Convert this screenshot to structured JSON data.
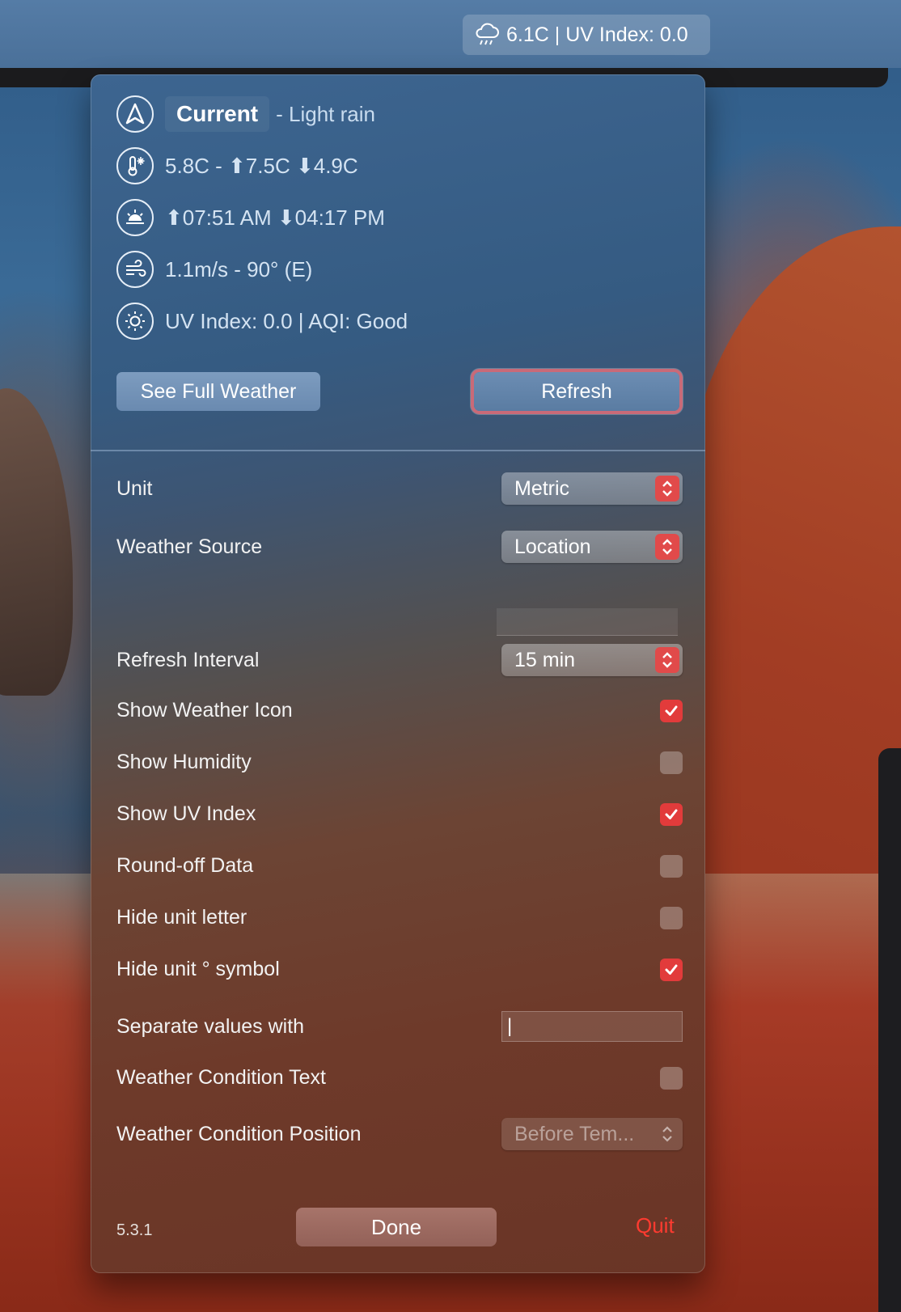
{
  "menubar": {
    "status_text": "6.1C | UV Index: 0.0",
    "status_icon": "cloud-rain-icon"
  },
  "current": {
    "label": "Current",
    "condition": "- Light rain",
    "temperature": "5.8C - ⬆7.5C ⬇4.9C",
    "sun_times": "⬆07:51 AM ⬇04:17 PM",
    "wind": "1.1m/s - 90° (E)",
    "uv_aqi": "UV Index: 0.0 | AQI: Good"
  },
  "buttons": {
    "see_full_weather": "See Full Weather",
    "refresh": "Refresh",
    "done": "Done",
    "quit": "Quit"
  },
  "settings": {
    "unit": {
      "label": "Unit",
      "value": "Metric"
    },
    "weather_source": {
      "label": "Weather Source",
      "value": "Location"
    },
    "refresh_interval": {
      "label": "Refresh Interval",
      "value": "15 min"
    },
    "show_weather_icon": {
      "label": "Show Weather Icon",
      "checked": true
    },
    "show_humidity": {
      "label": "Show Humidity",
      "checked": false
    },
    "show_uv_index": {
      "label": "Show UV Index",
      "checked": true
    },
    "round_off": {
      "label": "Round-off Data",
      "checked": false
    },
    "hide_unit_letter": {
      "label": "Hide unit letter",
      "checked": false
    },
    "hide_unit_symbol": {
      "label": "Hide unit ° symbol",
      "checked": true
    },
    "separator": {
      "label": "Separate values with",
      "value": "|"
    },
    "condition_text": {
      "label": "Weather Condition Text",
      "checked": false
    },
    "condition_position": {
      "label": "Weather Condition Position",
      "value": "Before Tem..."
    }
  },
  "version": "5.3.1",
  "colors": {
    "accent": "#e23b3b",
    "quit": "#ff3b30",
    "focus_ring": "#c96a78"
  }
}
